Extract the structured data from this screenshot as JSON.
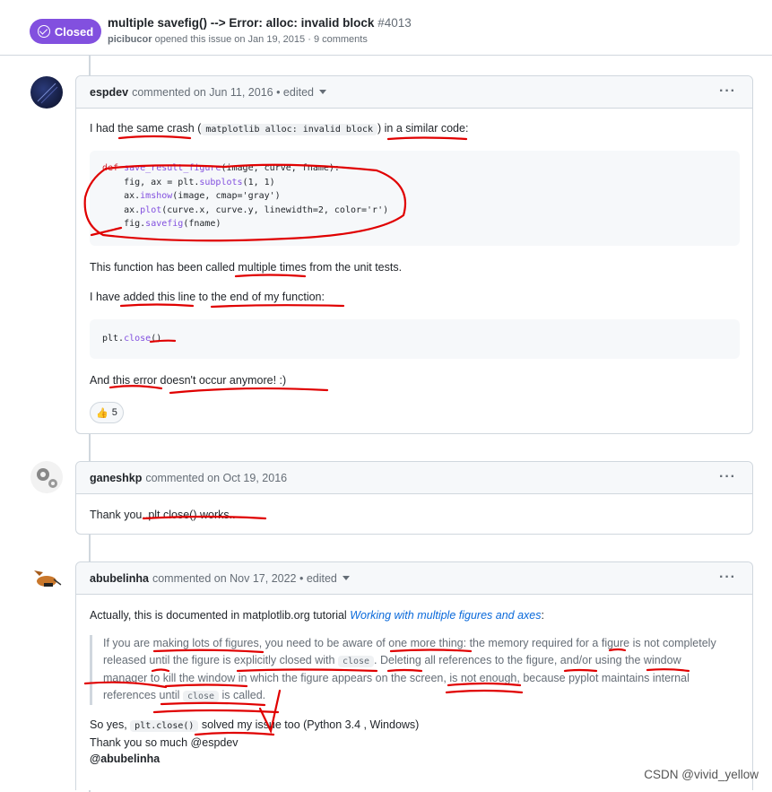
{
  "issue": {
    "status": "Closed",
    "title": "multiple savefig() --> Error: alloc: invalid block",
    "number": "#4013",
    "author": "picibucor",
    "opened_text": "opened this issue on Jan 19, 2015",
    "comments_count": "· 9 comments"
  },
  "c1": {
    "author": "espdev",
    "meta": "commented on Jun 11, 2016 • edited",
    "menu": "···",
    "p1_a": "I had the same crash (",
    "p1_code": "matplotlib alloc: invalid block",
    "p1_b": ") in a similar code:",
    "code1": [
      {
        "kw": "def ",
        "fn": "save_result_figure",
        "rest": "(image, curve, fname):"
      },
      {
        "pre": "    fig, ax = plt.",
        "fn": "subplots",
        "rest": "(1, 1)"
      },
      {
        "pre": "    ax.",
        "fn": "imshow",
        "rest": "(image, cmap='gray')"
      },
      {
        "pre": "    ax.",
        "fn": "plot",
        "rest": "(curve.x, curve.y, linewidth=2, color='r')"
      },
      {
        "pre": "    fig.",
        "fn": "savefig",
        "rest": "(fname)"
      }
    ],
    "p2": "This function has been called multiple times from the unit tests.",
    "p3": "I have added this line to the end of my function:",
    "code2_pre": "plt.",
    "code2_fn": "close",
    "code2_rest": "()",
    "p4": "And this error doesn't occur anymore! :)",
    "reaction_icon": "thumbs-up",
    "reaction_count": "5"
  },
  "c2": {
    "author": "ganeshkp",
    "meta": "commented on Oct 19, 2016",
    "menu": "···",
    "body": "Thank you..plt.close() works.."
  },
  "c3": {
    "author": "abubelinha",
    "meta": "commented on Nov 17, 2022 • edited",
    "menu": "···",
    "p1_a": "Actually, this is documented in matplotlib.org tutorial ",
    "p1_link": "Working with multiple figures and axes",
    "p1_b": ":",
    "q1": "If you are making lots of figures, you need to be aware of one more thing: the memory required for a figure is not completely",
    "q2_a": "released until the figure is explicitly closed with ",
    "q2_code": "close",
    "q2_b": ". Deleting all references to the figure, and/or using the window",
    "q3": "manager to kill the window in which the figure appears on the screen, is not enough, because pyplot maintains internal",
    "q4_a": "references until ",
    "q4_code": "close",
    "q4_b": " is called.",
    "p2_a": "So yes, ",
    "p2_code": "plt.close()",
    "p2_b": " solved my issue too (Python 3.4 , Windows)",
    "p3": "Thank you so much @espdev",
    "p4": "@abubelinha"
  },
  "watermark": "CSDN @vivid_yellow",
  "colors": {
    "closed": "#8250df",
    "annotation": "#e00000"
  }
}
